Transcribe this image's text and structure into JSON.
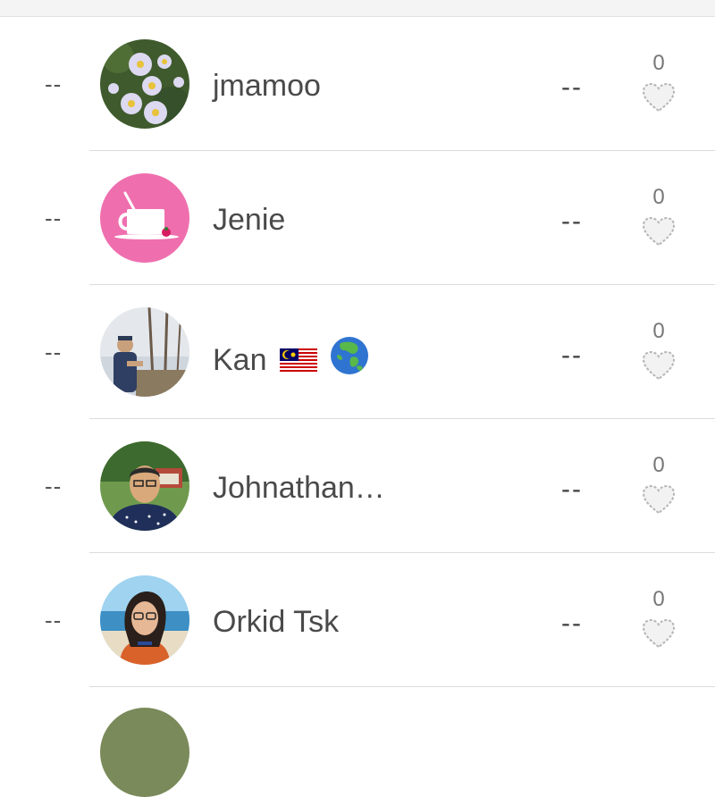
{
  "rows": [
    {
      "rank": "--",
      "name": "jmamoo",
      "score": "--",
      "likes": "0"
    },
    {
      "rank": "--",
      "name": "Jenie",
      "score": "--",
      "likes": "0"
    },
    {
      "rank": "--",
      "name": "Kan",
      "score": "--",
      "likes": "0"
    },
    {
      "rank": "--",
      "name": "Johnathan…",
      "score": "--",
      "likes": "0"
    },
    {
      "rank": "--",
      "name": "Orkid Tsk",
      "score": "--",
      "likes": "0"
    }
  ],
  "icons": {
    "like": "heart-outline-icon",
    "flag": "malaysia-flag-icon",
    "globe": "globe-asia-icon"
  },
  "colors": {
    "divider": "#dcdcdc",
    "text": "#4a4a4a",
    "heart_stroke": "#b5b5b5",
    "heart_fill": "#f2f2f2",
    "jenie_avatar": "#ef6fae"
  }
}
